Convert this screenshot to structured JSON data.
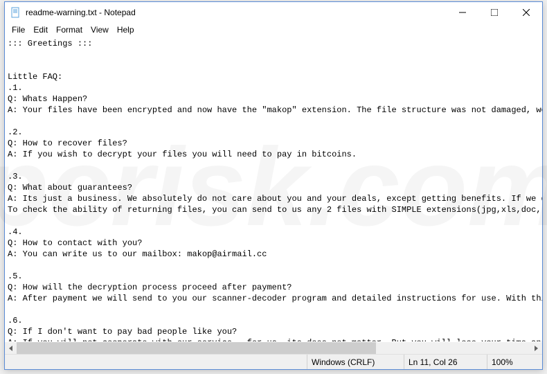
{
  "window": {
    "title": "readme-warning.txt - Notepad"
  },
  "menu": {
    "file": "File",
    "edit": "Edit",
    "format": "Format",
    "view": "View",
    "help": "Help"
  },
  "body_text": "::: Greetings :::\n\n\nLittle FAQ:\n.1.\nQ: Whats Happen?\nA: Your files have been encrypted and now have the \"makop\" extension. The file structure was not damaged, we\n\n.2.\nQ: How to recover files?\nA: If you wish to decrypt your files you will need to pay in bitcoins.\n\n.3.\nQ: What about guarantees?\nA: Its just a business. We absolutely do not care about you and your deals, except getting benefits. If we d\nTo check the ability of returning files, you can send to us any 2 files with SIMPLE extensions(jpg,xls,doc,\n\n.4.\nQ: How to contact with you?\nA: You can write us to our mailbox: makop@airmail.cc\n\n.5.\nQ: How will the decryption process proceed after payment?\nA: After payment we will send to you our scanner-decoder program and detailed instructions for use. With thi\n\n.6.\nQ: If I don't want to pay bad people like you?\nA: If you will not cooperate with our service - for us, its does not matter. But you will lose your time and\n",
  "status": {
    "encoding": "Windows (CRLF)",
    "position": "Ln 11, Col 26",
    "zoom": "100%"
  },
  "watermark": "pcrisk.com"
}
